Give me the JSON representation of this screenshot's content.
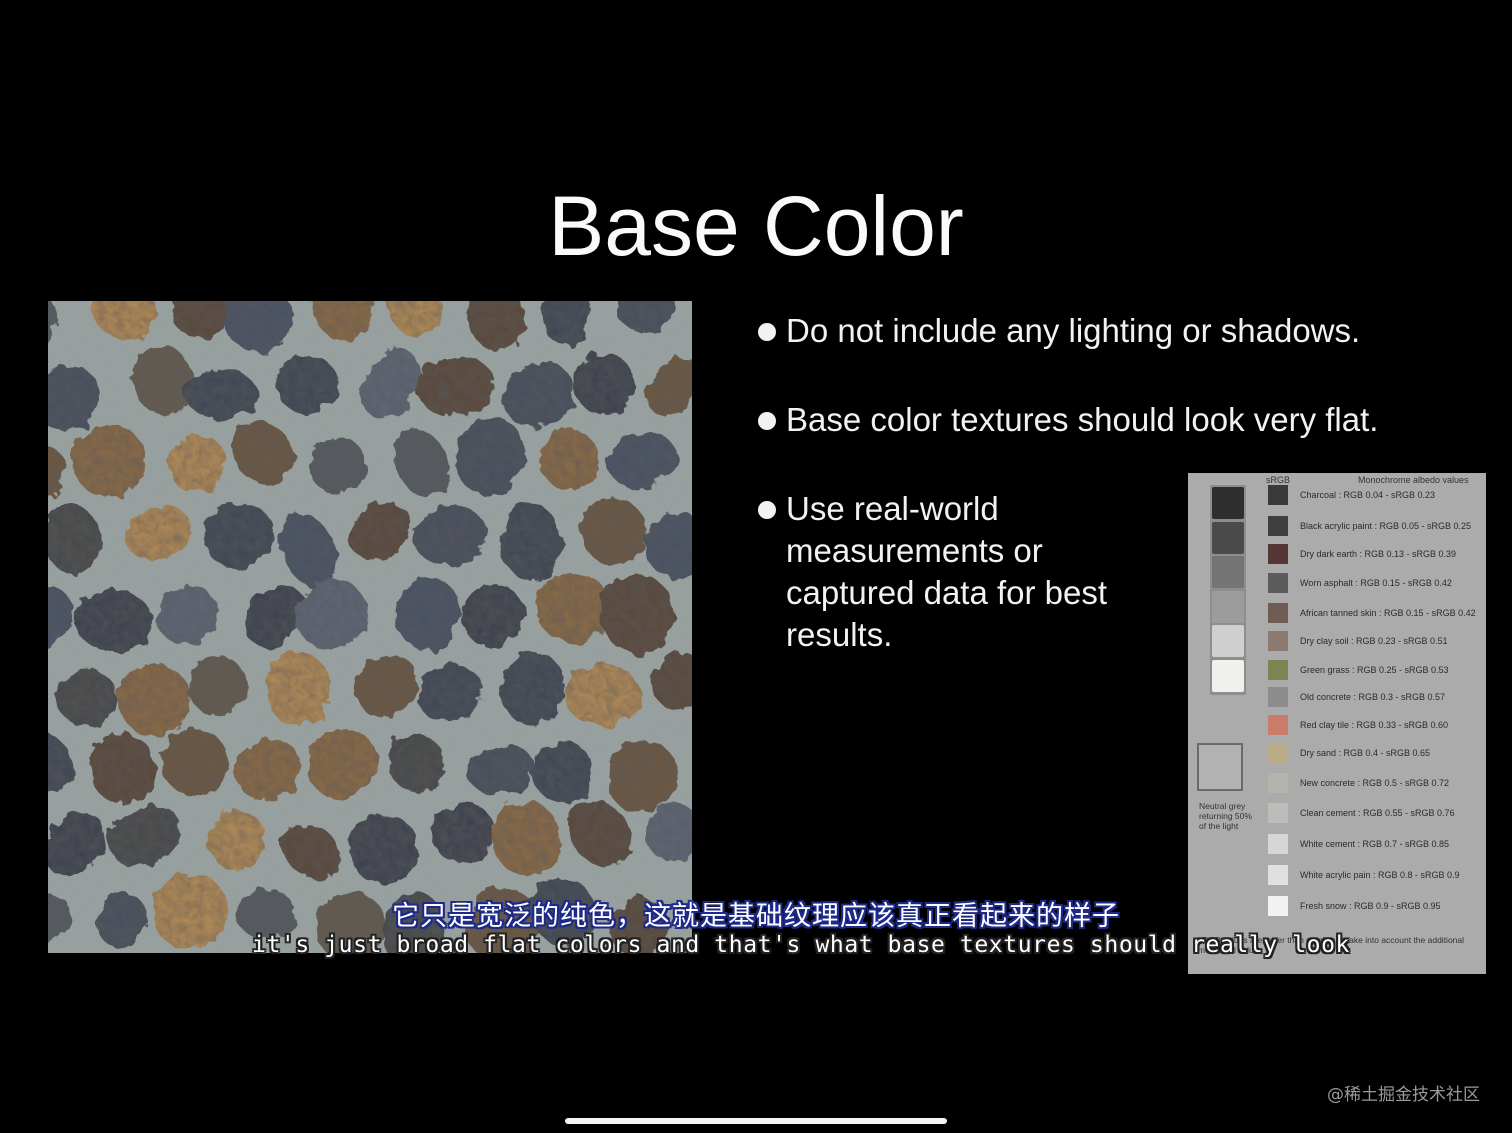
{
  "slide": {
    "title": "Base Color",
    "bullets": [
      "Do not include any lighting or shadows.",
      "Base color textures should look very flat.",
      "Use real-world measurements or captured data for best results."
    ]
  },
  "albedo_chart": {
    "left_header": "sRGB",
    "right_header": "Monochrome albedo values",
    "neutral_label": "Neutral grey returning 50% of the light",
    "grey_strip": [
      "#2e2e2e",
      "#4a4a4a",
      "#747474",
      "#9c9c9c",
      "#cfcfcf",
      "#f0f0ec"
    ],
    "entries": [
      {
        "label": "Charcoal : RGB 0.04 - sRGB 0.23",
        "color": "#3a3a3a"
      },
      {
        "label": "Black acrylic paint : RGB 0.05 - sRGB 0.25",
        "color": "#3f3f3f"
      },
      {
        "label": "Dry dark earth : RGB 0.13 - sRGB 0.39",
        "color": "#553836"
      },
      {
        "label": "Worn asphalt : RGB 0.15 - sRGB 0.42",
        "color": "#5c5c5c"
      },
      {
        "label": "African tanned skin : RGB 0.15 - sRGB 0.42",
        "color": "#6e5c55"
      },
      {
        "label": "Dry clay soil : RGB 0.23 - sRGB 0.51",
        "color": "#8b7a70"
      },
      {
        "label": "Green grass : RGB 0.25 - sRGB 0.53",
        "color": "#7e8452"
      },
      {
        "label": "Old concrete : RGB 0.3 - sRGB 0.57",
        "color": "#8c8c8c"
      },
      {
        "label": "Red clay tile : RGB 0.33 - sRGB 0.60",
        "color": "#c97c6a"
      },
      {
        "label": "Dry sand : RGB 0.4 - sRGB 0.65",
        "color": "#b8ad88"
      },
      {
        "label": "New concrete : RGB 0.5 - sRGB 0.72",
        "color": "#b5b3ae"
      },
      {
        "label": "Clean cement : RGB 0.55 - sRGB 0.76",
        "color": "#bdbcb8"
      },
      {
        "label": "White cement : RGB 0.7 - sRGB 0.85",
        "color": "#d6d6d6"
      },
      {
        "label": "White acrylic pain : RGB 0.8 - sRGB 0.9",
        "color": "#e0e0e0"
      },
      {
        "label": "Fresh snow : RGB 0.9 - sRGB 0.95",
        "color": "#f2f2f2"
      }
    ],
    "footnote": "sRGB values are lower than number to take into account the additional measured values"
  },
  "subtitles": {
    "chinese": "它只是宽泛的纯色，这就是基础纹理应该真正看起来的样子",
    "english": "it's just broad flat colors and that's what base textures should really look"
  },
  "watermark": "@稀土掘金技术社区"
}
